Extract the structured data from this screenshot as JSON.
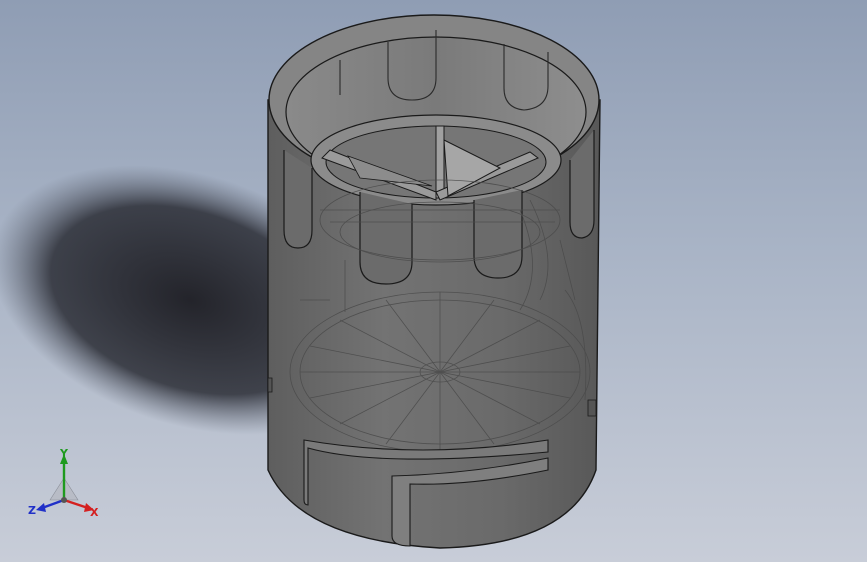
{
  "viewport": {
    "background_top": "#8f9db4",
    "background_bottom": "#c8cdd8",
    "model_color": "#6f6f6f",
    "edge_color": "#1a1a1a"
  },
  "triad": {
    "x_label": "X",
    "y_label": "Y",
    "z_label": "Z",
    "x_color": "#d42020",
    "y_color": "#1e9a1e",
    "z_color": "#2030c8"
  }
}
